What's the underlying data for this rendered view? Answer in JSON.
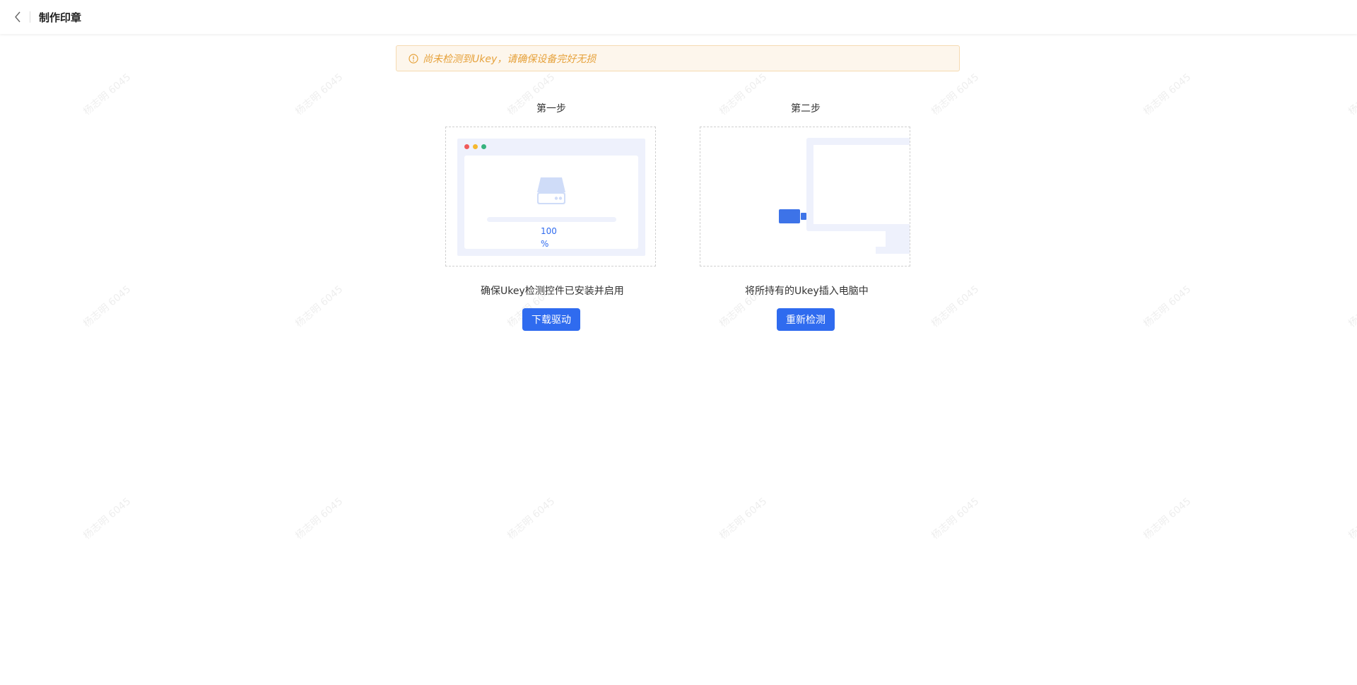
{
  "header": {
    "title": "制作印章",
    "back_icon": "chevron-left-icon"
  },
  "alert": {
    "text": "尚未检测到Ukey，请确保设备完好无损",
    "icon": "info-circle-icon",
    "color": "#e6a23c"
  },
  "watermark": {
    "text": "杨志明 6045"
  },
  "steps": [
    {
      "title": "第一步",
      "illustration": {
        "percent_value": "100",
        "percent_sign": "%",
        "progress": 1.0
      },
      "description": "确保Ukey检测控件已安装并启用",
      "button": "下载驱动"
    },
    {
      "title": "第二步",
      "description": "将所持有的Ukey插入电脑中",
      "button": "重新检测"
    }
  ],
  "colors": {
    "primary": "#2f6bef",
    "illustration_bg": "#eef1fc",
    "dot_red": "#f05a5a",
    "dot_yellow": "#f5b82e",
    "dot_green": "#36b37e"
  }
}
